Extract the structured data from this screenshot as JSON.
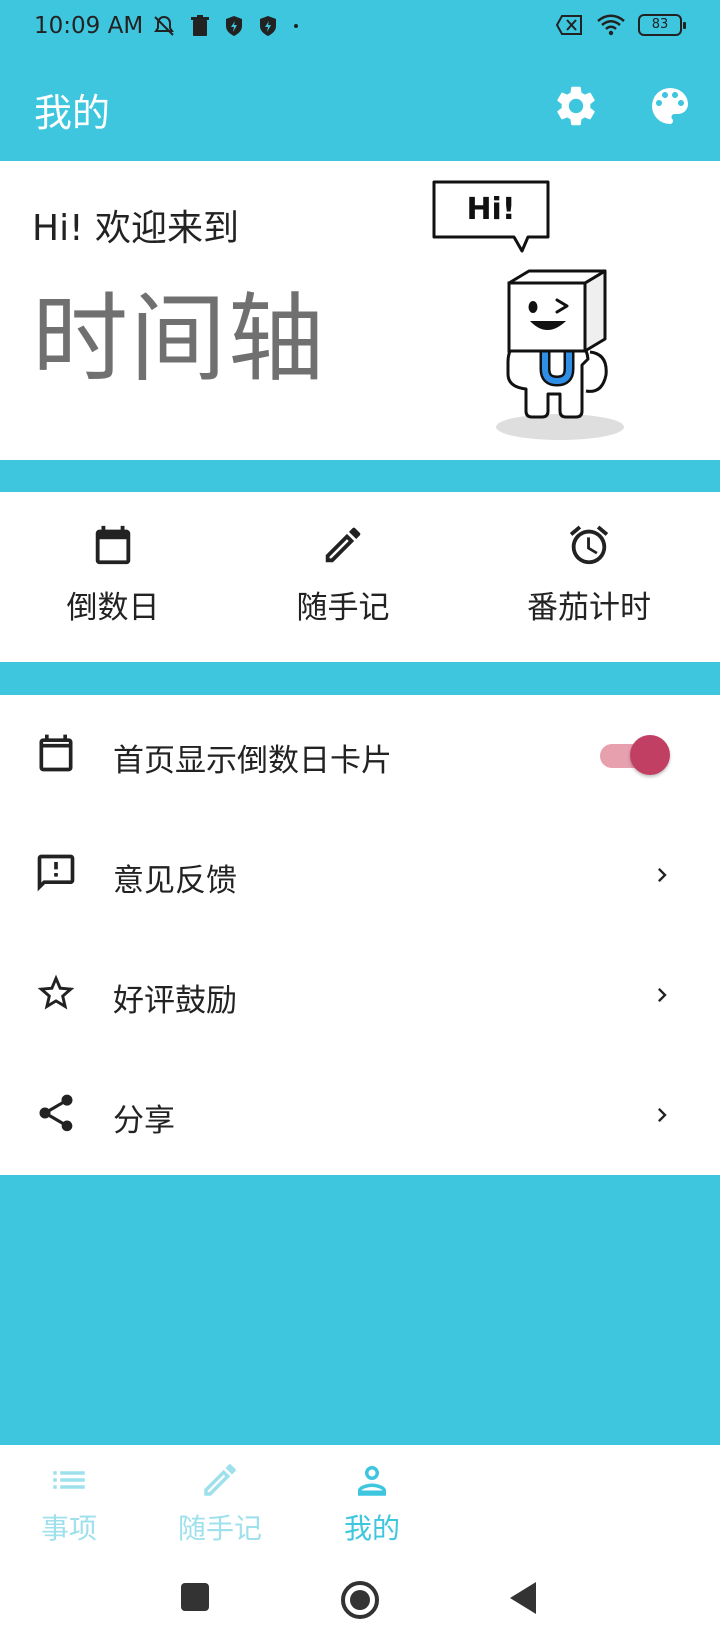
{
  "status_bar": {
    "time": "10:09 AM",
    "left_icons": [
      "mute-icon",
      "trash-icon",
      "shield-icon",
      "shield-icon",
      "dot-icon"
    ],
    "right_icons": [
      "sim-off-icon",
      "wifi-icon",
      "battery-icon"
    ],
    "battery": "83"
  },
  "app_bar": {
    "title": "我的",
    "actions": [
      "gear-icon",
      "palette-icon"
    ]
  },
  "hero": {
    "greeting": "Hi! 欢迎来到",
    "app_name": "时间轴",
    "bubble_text": "Hi!",
    "mascot_letter": "U"
  },
  "quick_actions": [
    {
      "label": "倒数日",
      "icon": "calendar-icon"
    },
    {
      "label": "随手记",
      "icon": "pencil-icon"
    },
    {
      "label": "番茄计时",
      "icon": "alarm-icon"
    }
  ],
  "settings": [
    {
      "label": "首页显示倒数日卡片",
      "icon": "calendar-icon",
      "control": "toggle",
      "toggle_on": true
    },
    {
      "label": "意见反馈",
      "icon": "feedback-icon",
      "control": "chevron"
    },
    {
      "label": "好评鼓励",
      "icon": "star-icon",
      "control": "chevron"
    },
    {
      "label": "分享",
      "icon": "share-icon",
      "control": "chevron"
    }
  ],
  "bottom_nav": [
    {
      "label": "事项",
      "icon": "list-icon",
      "active": false
    },
    {
      "label": "随手记",
      "icon": "pencil-icon",
      "active": false
    },
    {
      "label": "我的",
      "icon": "person-icon",
      "active": true
    }
  ],
  "colors": {
    "primary": "#3fc6df",
    "accent": "#c13f63",
    "accent_track": "#e7a0ae",
    "nav_active": "#3fc6df",
    "nav_inactive": "#9ee0ec",
    "hero_name": "#707070"
  }
}
